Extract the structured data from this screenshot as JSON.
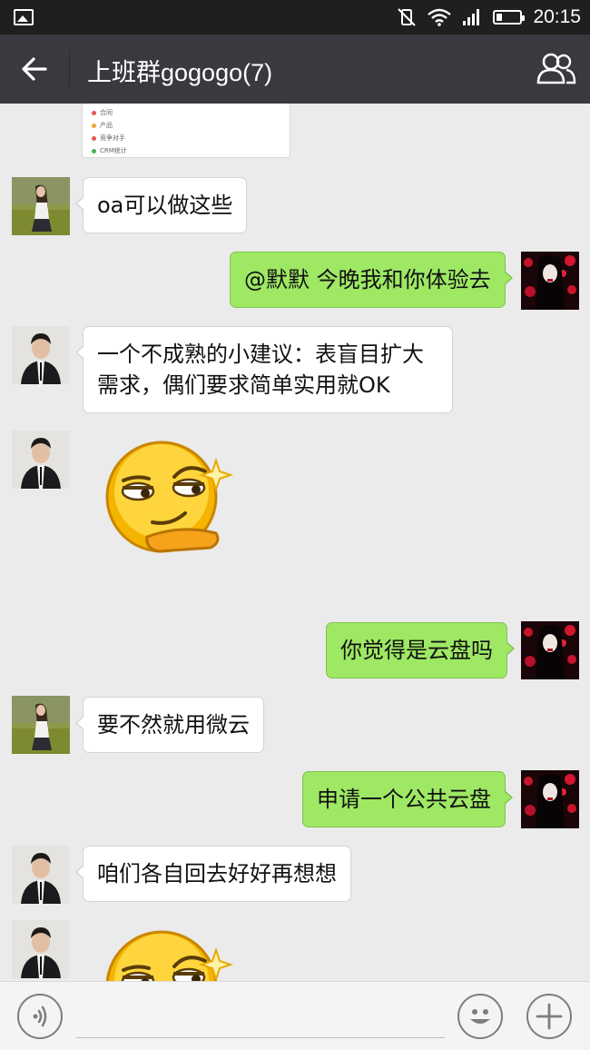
{
  "status_bar": {
    "time": "20:15",
    "icons": [
      "gallery-icon",
      "vibrate-icon",
      "wifi-icon",
      "signal-icon",
      "battery-icon"
    ]
  },
  "header": {
    "title": "上班群gogogo(7)",
    "back_icon": "arrow-left-icon",
    "group_icon": "group-members-icon"
  },
  "shared_image": {
    "items": [
      "合同",
      "产品",
      "竞争对手",
      "CRM统计"
    ],
    "dot_colors": [
      "#e25a4e",
      "#f2a33a",
      "#e25a4e",
      "#4caf50"
    ]
  },
  "messages": [
    {
      "side": "left",
      "sender_avatar": "girl-avatar",
      "text": "oa可以做这些"
    },
    {
      "side": "right",
      "sender_avatar": "anime-avatar",
      "text": "@默默 今晚我和你体验去"
    },
    {
      "side": "left",
      "sender_avatar": "man-avatar",
      "text": "一个不成熟的小建议：表盲目扩大需求，偶们要求简单实用就OK"
    },
    {
      "side": "left",
      "sender_avatar": "man-avatar",
      "sticker": "smug-emoji-sticker"
    },
    {
      "side": "right",
      "sender_avatar": "anime-avatar",
      "text": "你觉得是云盘吗"
    },
    {
      "side": "left",
      "sender_avatar": "girl-avatar",
      "text": "要不然就用微云"
    },
    {
      "side": "right",
      "sender_avatar": "anime-avatar",
      "text": "申请一个公共云盘"
    },
    {
      "side": "left",
      "sender_avatar": "man-avatar",
      "text": "咱们各自回去好好再想想"
    },
    {
      "side": "left",
      "sender_avatar": "man-avatar",
      "sticker": "smug-emoji-sticker"
    }
  ],
  "input_bar": {
    "voice_icon": "voice-icon",
    "emoji_icon": "emoji-icon",
    "plus_icon": "plus-icon",
    "text_value": ""
  },
  "colors": {
    "title_bar": "#393a3f",
    "status_bar": "#1f1f1f",
    "chat_background": "#ebebeb",
    "bubble_self": "#9ee864",
    "bubble_other": "#ffffff"
  }
}
